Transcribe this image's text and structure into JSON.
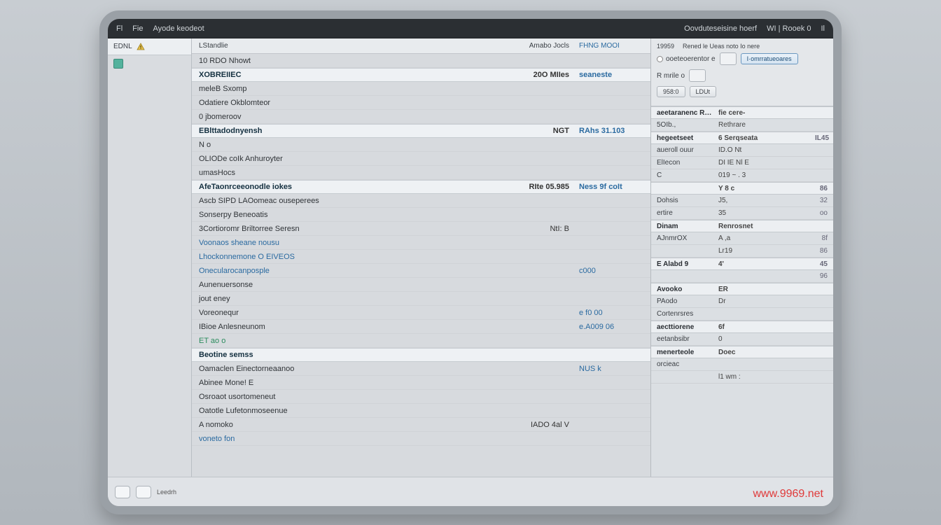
{
  "titlebar": {
    "left1": "Fl",
    "left2": "Fie",
    "left3": "Ayode keodeot",
    "right1": "Oovduteseisine hoerf",
    "right2": "WI | Rooek 0",
    "right3": "Il"
  },
  "gutter": {
    "tab1": "EDNL",
    "icon_row": ""
  },
  "columns": {
    "name": "LStandlie",
    "a": "Amabo Jocls",
    "b": "FHNG  MOOI"
  },
  "rows": [
    {
      "type": "row",
      "name": "10 RDO   Nhowt",
      "a": "",
      "b": ""
    },
    {
      "type": "header",
      "name": "XOBREIIEC",
      "a": "20O MIIes",
      "b": "seaneste"
    },
    {
      "type": "row",
      "name": "meleB Sxomp",
      "a": "",
      "b": ""
    },
    {
      "type": "row",
      "name": "Odatiere Okblomteor",
      "a": "",
      "b": ""
    },
    {
      "type": "row",
      "name": "0 jbomeroov",
      "a": "",
      "b": ""
    },
    {
      "type": "header",
      "name": "EBlttadodnyensh",
      "a": "NGT",
      "b": "RAhs   31.103"
    },
    {
      "type": "row",
      "name": "N o",
      "a": "",
      "b": ""
    },
    {
      "type": "row",
      "name": "OLIODe coIk Anhuroyter",
      "a": "",
      "b": ""
    },
    {
      "type": "row",
      "name": "umasHocs",
      "a": "",
      "b": ""
    },
    {
      "type": "header",
      "name": "AfeTaonrceeonodle iokes",
      "a": "RIte 05.985",
      "b": "Ness   9f coIt"
    },
    {
      "type": "row",
      "name": "Ascb   SIPD LAOomeac ouseperees",
      "a": "",
      "b": ""
    },
    {
      "type": "row",
      "name": "Sonserpy Beneoatis",
      "a": "",
      "b": ""
    },
    {
      "type": "row",
      "name": "3Cortioromr Briltorree Seresn",
      "a": "NtI: B",
      "b": ""
    },
    {
      "type": "link",
      "name": "Voonaos sheane nousu",
      "a": "",
      "b": ""
    },
    {
      "type": "link",
      "name": "Lhockonnemone O EIVEOS",
      "a": "",
      "b": ""
    },
    {
      "type": "link",
      "name": "Onecularocanposple",
      "a": "",
      "b": "c000"
    },
    {
      "type": "row",
      "name": "Aunenuersonse",
      "a": "",
      "b": ""
    },
    {
      "type": "row",
      "name": "jout  eney",
      "a": "",
      "b": ""
    },
    {
      "type": "row",
      "name": "Voreonequr",
      "a": "",
      "b": "e f0 00"
    },
    {
      "type": "row",
      "name": "IBioe  Anlesneunom",
      "a": "",
      "b": "e.A009 06"
    },
    {
      "type": "green",
      "name": "ET ao o",
      "a": "",
      "b": ""
    },
    {
      "type": "header",
      "name": "Beotine semss",
      "a": "",
      "b": ""
    },
    {
      "type": "row",
      "name": "Oamaclen Einectorneaanoo",
      "a": "",
      "b": "NUS k"
    },
    {
      "type": "row",
      "name": "Abinee Mone! E",
      "a": "",
      "b": ""
    },
    {
      "type": "row",
      "name": "Osroaot usortomeneut",
      "a": "",
      "b": ""
    },
    {
      "type": "row",
      "name": "Oatotle Lufetonmoseenue",
      "a": "",
      "b": ""
    },
    {
      "type": "row",
      "name": "A nomoko",
      "a": "IADO   4al V",
      "b": ""
    },
    {
      "type": "link",
      "name": "voneto fon",
      "a": "",
      "b": ""
    }
  ],
  "inspector": {
    "top_label1": "19959",
    "top_label2": "Rened le Ueas noto Io nere",
    "radio": "ooeteoerentor e",
    "btn_primary": "I·omrratueoares",
    "btn_small1": "R  mrile  o",
    "btn_gray1": "958:0",
    "btn_gray2": "LDUt",
    "groups": [
      {
        "head": true,
        "label": "aeetaranenc ROFn",
        "value": "fie cere-",
        "right": ""
      },
      {
        "label": "5OIb.,",
        "value": "Rethrare",
        "right": ""
      },
      {
        "head": true,
        "label": "hegeetseet",
        "value": "6 Serqseata",
        "right": "IL45"
      },
      {
        "label": "aueroll ouur",
        "value": "ID.O Nt",
        "right": ""
      },
      {
        "label": "ElIecon",
        "value": "DI   IE   Nl  E",
        "right": ""
      },
      {
        "label": "C",
        "value": "019   ~ . 3",
        "right": ""
      },
      {
        "head": true,
        "label": "",
        "value": "Y 8 c",
        "right": "86"
      },
      {
        "label": "Dohsis",
        "value": "J5,",
        "right": "32"
      },
      {
        "label": "ertire",
        "value": "35",
        "right": "oo"
      },
      {
        "head": true,
        "label": "Dinam",
        "value": "Renrosnet",
        "right": ""
      },
      {
        "label": "AJnmrOX",
        "value": "A ,a",
        "right": "8f"
      },
      {
        "label": "",
        "value": "Lr19",
        "right": "86"
      },
      {
        "head": true,
        "label": "E Alabd 9",
        "value": "4'",
        "right": "45"
      },
      {
        "label": "",
        "value": "",
        "right": "96"
      },
      {
        "head": true,
        "label": "Avooko",
        "value": "ER",
        "right": ""
      },
      {
        "label": "PAodo",
        "value": "Dr",
        "right": ""
      },
      {
        "label": "Cortenrsres",
        "value": "",
        "right": ""
      },
      {
        "head": true,
        "label": "aecttiorene",
        "value": "6f",
        "right": ""
      },
      {
        "label": "eetanbsibr",
        "value": "0",
        "right": ""
      },
      {
        "head": true,
        "label": "menerteole",
        "value": "Doec",
        "right": ""
      },
      {
        "label": "orcieac",
        "value": "",
        "right": ""
      },
      {
        "label": "",
        "value": "l1 wm   :",
        "right": ""
      }
    ]
  },
  "status": {
    "label": "Leedrh"
  },
  "watermark": "www.9969.net"
}
